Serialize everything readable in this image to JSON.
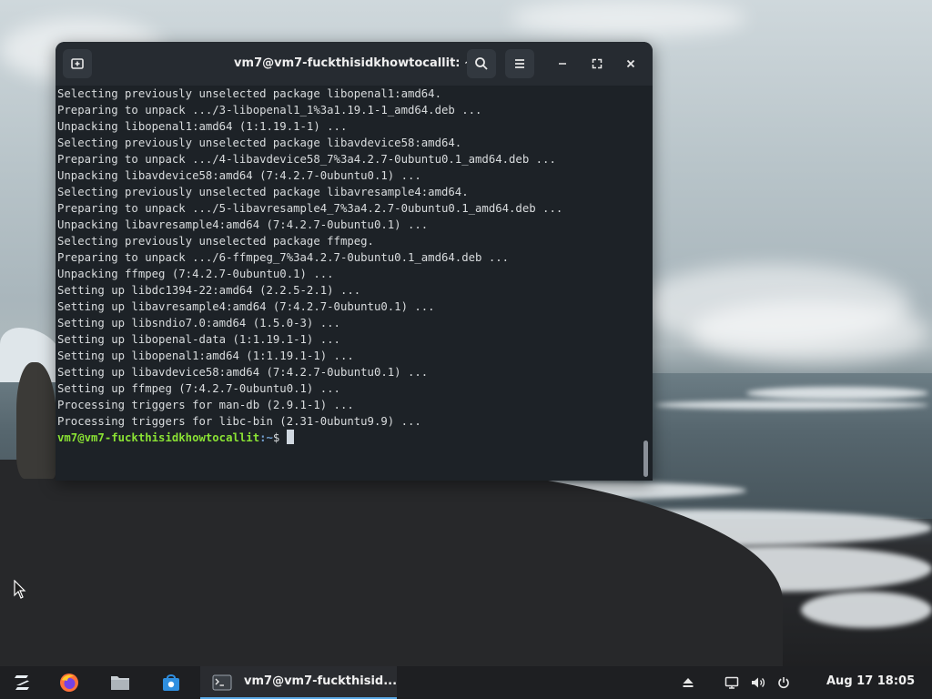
{
  "terminal": {
    "title": "vm7@vm7-fuckthisidkhowtocallit: ~",
    "lines": [
      "Selecting previously unselected package libopenal1:amd64.",
      "Preparing to unpack .../3-libopenal1_1%3a1.19.1-1_amd64.deb ...",
      "Unpacking libopenal1:amd64 (1:1.19.1-1) ...",
      "Selecting previously unselected package libavdevice58:amd64.",
      "Preparing to unpack .../4-libavdevice58_7%3a4.2.7-0ubuntu0.1_amd64.deb ...",
      "Unpacking libavdevice58:amd64 (7:4.2.7-0ubuntu0.1) ...",
      "Selecting previously unselected package libavresample4:amd64.",
      "Preparing to unpack .../5-libavresample4_7%3a4.2.7-0ubuntu0.1_amd64.deb ...",
      "Unpacking libavresample4:amd64 (7:4.2.7-0ubuntu0.1) ...",
      "Selecting previously unselected package ffmpeg.",
      "Preparing to unpack .../6-ffmpeg_7%3a4.2.7-0ubuntu0.1_amd64.deb ...",
      "Unpacking ffmpeg (7:4.2.7-0ubuntu0.1) ...",
      "Setting up libdc1394-22:amd64 (2.2.5-2.1) ...",
      "Setting up libavresample4:amd64 (7:4.2.7-0ubuntu0.1) ...",
      "Setting up libsndio7.0:amd64 (1.5.0-3) ...",
      "Setting up libopenal-data (1:1.19.1-1) ...",
      "Setting up libopenal1:amd64 (1:1.19.1-1) ...",
      "Setting up libavdevice58:amd64 (7:4.2.7-0ubuntu0.1) ...",
      "Setting up ffmpeg (7:4.2.7-0ubuntu0.1) ...",
      "Processing triggers for man-db (2.9.1-1) ...",
      "Processing triggers for libc-bin (2.31-0ubuntu9.9) ..."
    ],
    "prompt": {
      "user_host": "vm7@vm7-fuckthisidkhowtocallit",
      "path": ":~",
      "symbol": "$"
    },
    "colors": {
      "prompt_user": "#8ae234",
      "prompt_path": "#729fcf",
      "background": "#1d2227"
    }
  },
  "taskbar": {
    "apps": [
      {
        "icon": "zorin-menu-icon"
      },
      {
        "icon": "firefox-icon"
      },
      {
        "icon": "files-folder-icon"
      },
      {
        "icon": "software-store-icon"
      }
    ],
    "active_task": {
      "icon": "terminal-icon",
      "label": "vm7@vm7-fuckthisid..."
    },
    "tray": [
      "eject-icon",
      "display-icon",
      "volume-icon",
      "power-icon"
    ],
    "clock": "Aug 17  18:05",
    "accent": "#5aa9e6"
  }
}
